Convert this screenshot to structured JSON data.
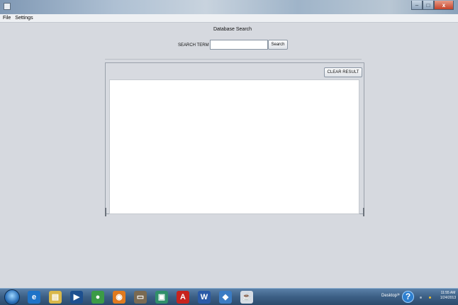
{
  "window": {
    "controls": {
      "minimize": "–",
      "maximize": "□",
      "close": "x"
    }
  },
  "menubar": {
    "items": [
      "File",
      "Settings"
    ]
  },
  "main": {
    "title": "Database Search",
    "search": {
      "label": "SEARCH TERM",
      "value": "",
      "button_label": "Search"
    },
    "results": {
      "clear_button_label": "CLEAR RESULT",
      "content": ""
    }
  },
  "taskbar": {
    "icons": [
      {
        "name": "internet-explorer-icon",
        "glyph": "e",
        "color": "#1e73c8"
      },
      {
        "name": "file-explorer-icon",
        "glyph": "▤",
        "color": "#d9b84a"
      },
      {
        "name": "media-player-icon",
        "glyph": "▶",
        "color": "#1d4f8f"
      },
      {
        "name": "chrome-icon",
        "glyph": "●",
        "color": "#3b9b46"
      },
      {
        "name": "firefox-icon",
        "glyph": "◉",
        "color": "#e07a1f"
      },
      {
        "name": "network-icon",
        "glyph": "▭",
        "color": "#7a6a52"
      },
      {
        "name": "app-icon",
        "glyph": "▣",
        "color": "#2f8f6a"
      },
      {
        "name": "acrobat-icon",
        "glyph": "A",
        "color": "#c7231e"
      },
      {
        "name": "word-icon",
        "glyph": "W",
        "color": "#2a5aa8"
      },
      {
        "name": "virtualbox-icon",
        "glyph": "◆",
        "color": "#3b7cc4"
      },
      {
        "name": "java-icon",
        "glyph": "☕",
        "color": "#d7dde5"
      }
    ],
    "tray": {
      "desktop_label": "Desktop",
      "time": "11:55 AM",
      "date": "1/24/2013"
    }
  },
  "colors": {
    "background": "#d6d9df",
    "result_area": "#ffffff",
    "taskbar": "#3c5f85"
  }
}
